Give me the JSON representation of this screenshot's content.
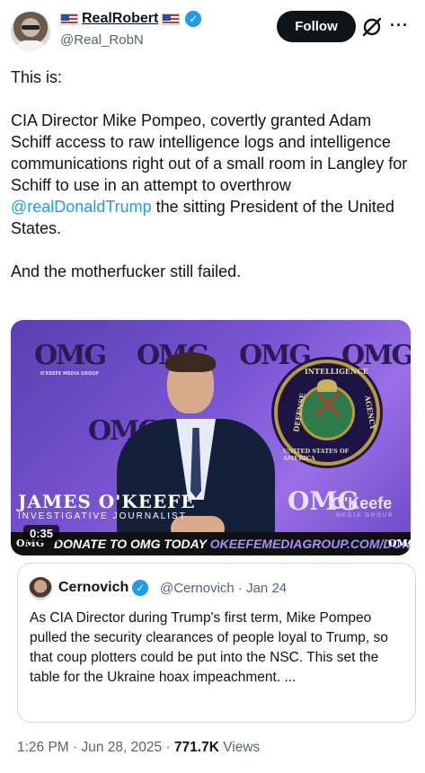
{
  "author": {
    "display_name": "RealRobert",
    "handle": "@Real_RobN",
    "verified": true,
    "flag_icon": "us-flag-icon"
  },
  "actions": {
    "follow_label": "Follow",
    "grok_icon": "grok-icon",
    "more_label": "···"
  },
  "tweet": {
    "para1": "This is:",
    "para2_before": "CIA Director Mike Pompeo, covertly granted Adam Schiff access to raw intelligence logs and intelligence communications right out of a small room in Langley for Schiff to use in an attempt to overthrow ",
    "para2_mention": "@realDonaldTrump",
    "para2_after": " the sitting President of the United States.",
    "para3": "And the motherfucker still failed."
  },
  "video": {
    "logo_text": "OMG",
    "logo_caption": "O'KEEFE MEDIA GROUP",
    "seal_top": "INTELLIGENCE",
    "seal_left": "DEFENSE",
    "seal_right": "AGENCY",
    "seal_bottom": "UNITED STATES OF AMERICA",
    "speaker_name": "JAMES O'KEEFE",
    "speaker_title": "INVESTIGATIVE JOURNALIST",
    "brand_name": "O'Keefe",
    "brand_sub": "MEDIA GROUP",
    "ticker_text": "DONATE TO OMG TODAY ",
    "ticker_url": "OKEEFEMEDIAGROUP.COM/DONATE",
    "timestamp": "0:35"
  },
  "quote": {
    "display_name": "Cernovich",
    "verified": true,
    "meta": "@Cernovich · Jan 24",
    "text": "As CIA Director during Trump's first term, Mike Pompeo pulled the security clearances of people loyal to Trump, so that coup plotters could be put into the NSC. This set the table for the Ukraine hoax impeachment. ..."
  },
  "footer": {
    "time_date": "1:26 PM · Jun 28, 2025 · ",
    "views_count": "771.7K",
    "views_label": " Views"
  },
  "colors": {
    "accent": "#1d9bf0",
    "text": "#0f1419",
    "muted": "#536471",
    "follow_bg": "#0f1419"
  }
}
